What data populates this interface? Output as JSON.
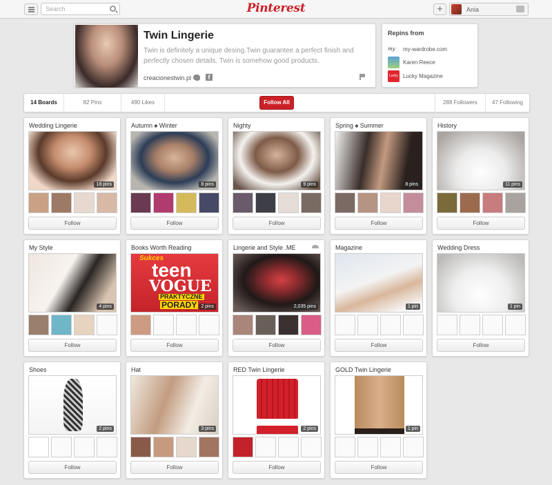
{
  "header": {
    "logo": "Pinterest",
    "search_placeholder": "Search",
    "plus_label": "+",
    "user_name": "Ania"
  },
  "profile": {
    "name": "Twin Lingerie",
    "description": "Twin is definitely a unique desing.Twin guarantee a perfect finish and perfectly chosen details. Twin is somehow good products.",
    "website": "creacionestwin.pl ·",
    "facebook_glyph": "f"
  },
  "repins": {
    "title": "Repins from",
    "items": [
      {
        "label": "my-wardrobe.com",
        "thumb": "my"
      },
      {
        "label": "Karen Reece",
        "thumb": ""
      },
      {
        "label": "Lucky Magazine",
        "thumb": "Lucky"
      }
    ]
  },
  "tabs": {
    "boards": "14 Boards",
    "pins": "82 Pins",
    "likes": "490 Likes",
    "follow_all": "Follow All",
    "followers": "288 Followers",
    "following": "47 Following"
  },
  "boards": [
    {
      "title": "Wedding Lingerie",
      "pins": "18 pins",
      "follow": "Follow"
    },
    {
      "title": "Autumn ♠ Winter",
      "pins": "8 pins",
      "follow": "Follow"
    },
    {
      "title": "Nighty",
      "pins": "9 pins",
      "follow": "Follow"
    },
    {
      "title": "Spring ♠ Summer",
      "pins": "8 pins",
      "follow": "Follow"
    },
    {
      "title": "History",
      "pins": "11 pins",
      "follow": "Follow"
    },
    {
      "title": "My Style",
      "pins": "4 pins",
      "follow": "Follow"
    },
    {
      "title": "Books Worth Reading",
      "pins": "2 pins",
      "follow": "Follow"
    },
    {
      "title": "Lingerie and Style .ME",
      "pins": "2,035 pins",
      "follow": "Follow"
    },
    {
      "title": "Magazine",
      "pins": "1 pin",
      "follow": "Follow"
    },
    {
      "title": "Wedding Dress",
      "pins": "1 pin",
      "follow": "Follow"
    },
    {
      "title": "Shoes",
      "pins": "2 pins",
      "follow": "Follow"
    },
    {
      "title": "Hat",
      "pins": "3 pins",
      "follow": "Follow"
    },
    {
      "title": "RED Twin Lingerie",
      "pins": "2 pins",
      "follow": "Follow"
    },
    {
      "title": "GOLD Twin Lingerie",
      "pins": "1 pin",
      "follow": "Follow"
    }
  ],
  "book_cover": {
    "line1": "Sukces",
    "line2": "teen",
    "line3": "VOGUE",
    "line4": "PRAKTYCZNE",
    "line5": "PORADY"
  }
}
